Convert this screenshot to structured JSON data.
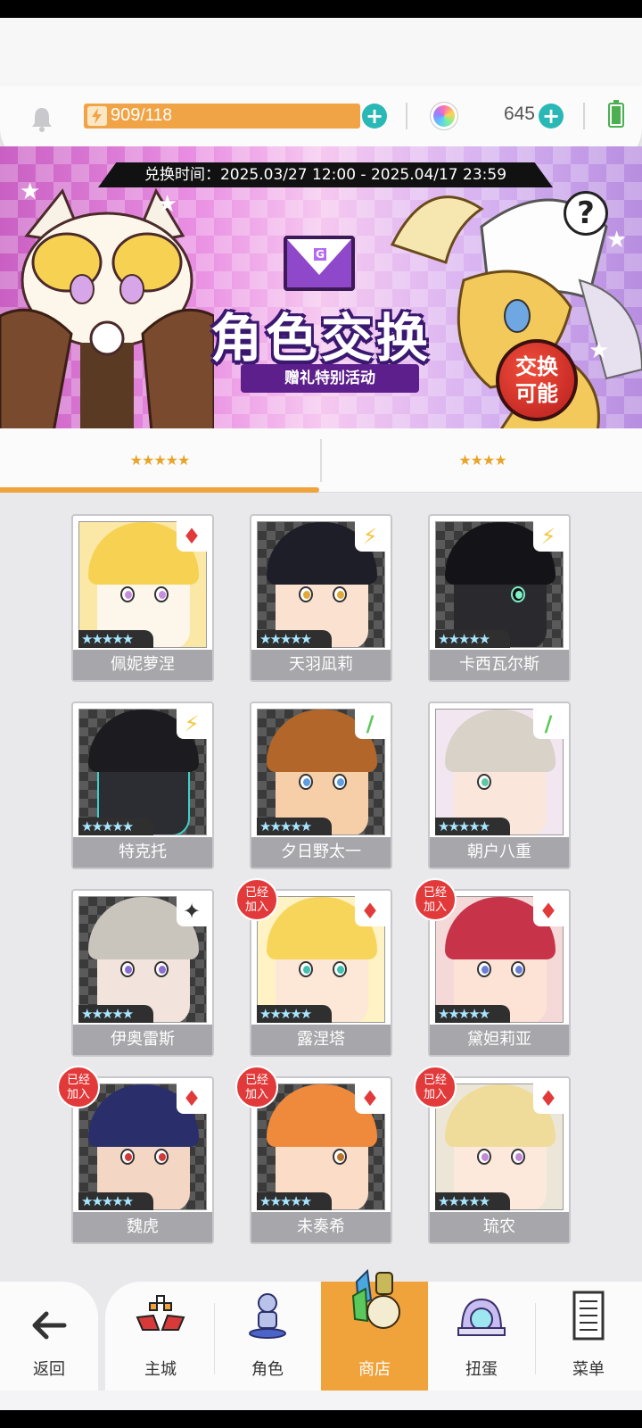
{
  "resources": {
    "energy_current": "909",
    "energy_max": "/118",
    "gems": "645"
  },
  "banner": {
    "exchange_time": "兑换时间：2025.03/27 12:00 - 2025.04/17 23:59",
    "title": "角色交换",
    "subtitle": "赠礼特别活动",
    "badge_line1": "交换",
    "badge_line2": "可能",
    "help_icon": "?"
  },
  "tabs": [
    {
      "label": "★★★★★",
      "selected": true
    },
    {
      "label": "★★★★",
      "selected": false
    }
  ],
  "characters": [
    {
      "name": "佩妮萝涅",
      "stars": "★★★★★",
      "element": "diamond-icon",
      "element_glyph": "♦",
      "joined": false
    },
    {
      "name": "天羽凪莉",
      "stars": "★★★★★",
      "element": "lightning-icon",
      "element_glyph": "⚡",
      "joined": false
    },
    {
      "name": "卡西瓦尔斯",
      "stars": "★★★★★",
      "element": "lightning-icon",
      "element_glyph": "⚡",
      "joined": false
    },
    {
      "name": "特克托",
      "stars": "★★★★★",
      "element": "lightning-icon",
      "element_glyph": "⚡",
      "joined": false
    },
    {
      "name": "夕日野太一",
      "stars": "★★★★★",
      "element": "leaf-icon",
      "element_glyph": "/",
      "joined": false
    },
    {
      "name": "朝户八重",
      "stars": "★★★★★",
      "element": "leaf-icon",
      "element_glyph": "/",
      "joined": false
    },
    {
      "name": "伊奥雷斯",
      "stars": "★★★★★",
      "element": "dark-star-icon",
      "element_glyph": "✦",
      "joined": false
    },
    {
      "name": "露涅塔",
      "stars": "★★★★★",
      "element": "diamond-icon",
      "element_glyph": "♦",
      "joined": true
    },
    {
      "name": "黛妲莉亚",
      "stars": "★★★★★",
      "element": "diamond-icon",
      "element_glyph": "♦",
      "joined": true
    },
    {
      "name": "魏虎",
      "stars": "★★★★★",
      "element": "diamond-icon",
      "element_glyph": "♦",
      "joined": true
    },
    {
      "name": "未奏希",
      "stars": "★★★★★",
      "element": "diamond-icon",
      "element_glyph": "♦",
      "joined": true
    },
    {
      "name": "琉农",
      "stars": "★★★★★",
      "element": "diamond-icon",
      "element_glyph": "♦",
      "joined": true
    }
  ],
  "joined_label": "已经加入",
  "nav": {
    "back": "返回",
    "items": [
      {
        "label": "主城",
        "icon": "castle-icon"
      },
      {
        "label": "角色",
        "icon": "character-icon"
      },
      {
        "label": "商店",
        "icon": "shop-icon",
        "active": true
      },
      {
        "label": "扭蛋",
        "icon": "gacha-icon"
      },
      {
        "label": "菜单",
        "icon": "menu-icon"
      }
    ]
  },
  "colors": {
    "accent": "#f0a23b",
    "plus": "#29b8b5",
    "joined_badge": "#e23a3a",
    "name_bar": "#a6a6ab"
  }
}
